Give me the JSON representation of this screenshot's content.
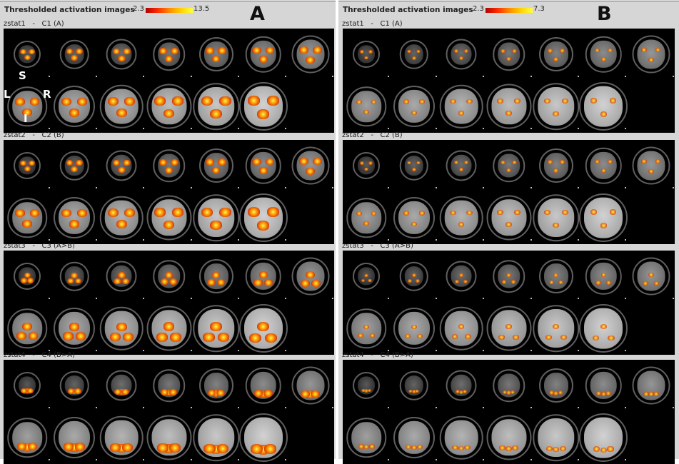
{
  "panels": [
    {
      "title": "Thresholded activation images",
      "colorbar_min": "2.3",
      "colorbar_max": "13.5",
      "letter": "A",
      "orientation": {
        "superior": "S",
        "left": "L",
        "right": "R",
        "inferior": "I"
      },
      "sections": [
        {
          "label": "zstat1   -   C1 (A)"
        },
        {
          "label": "zstat2   -   C2 (B)"
        },
        {
          "label": "zstat3   -   C3 (A>B)"
        },
        {
          "label": "zstat4   -   C4 (B>A)"
        }
      ]
    },
    {
      "title": "Thresholded activation images",
      "colorbar_min": "2.3",
      "colorbar_max": "7.3",
      "letter": "B",
      "sections": [
        {
          "label": "zstat1   -   C1 (A)"
        },
        {
          "label": "zstat2   -   C2 (B)"
        },
        {
          "label": "zstat3   -   C3 (A>B)"
        },
        {
          "label": "zstat4   -   C4 (B>A)"
        }
      ]
    }
  ],
  "colors": {
    "background": "#d6d6d6",
    "image_background": "#000000",
    "activation_low": "#b00000",
    "activation_high": "#ffff40"
  }
}
